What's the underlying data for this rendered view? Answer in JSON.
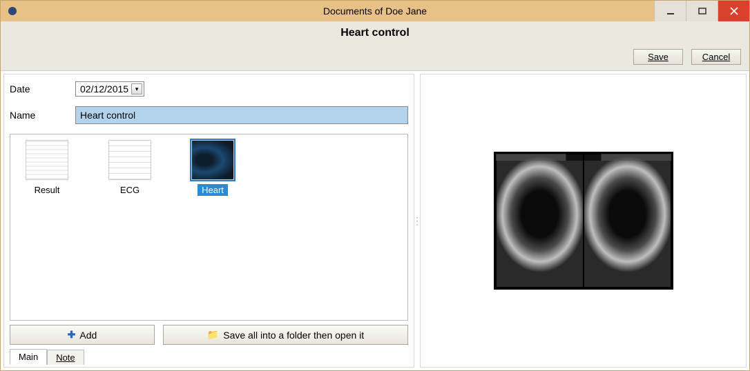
{
  "window": {
    "title": "Documents of Doe Jane"
  },
  "header": {
    "subtitle": "Heart control",
    "save_label": "Save",
    "cancel_label": "Cancel"
  },
  "form": {
    "date_label": "Date",
    "date_value": "02/12/2015",
    "name_label": "Name",
    "name_value": "Heart control"
  },
  "thumbnails": {
    "items": [
      {
        "label": "Result",
        "icon": "result-doc-icon",
        "selected": false
      },
      {
        "label": "ECG",
        "icon": "ecg-grid-icon",
        "selected": false
      },
      {
        "label": "Heart",
        "icon": "ultrasound-icon",
        "selected": true
      }
    ]
  },
  "actions": {
    "add_label": "Add",
    "saveall_label": "Save all into a folder then open it"
  },
  "tabs": {
    "items": [
      {
        "label": "Main",
        "active": true
      },
      {
        "label": "Note",
        "active": false
      }
    ]
  },
  "preview": {
    "kind": "ultrasound-image",
    "description": "Dual-view cardiac ultrasound preview"
  },
  "colors": {
    "titlebar_bg": "#e8c187",
    "close_bg": "#d9412c",
    "selection_bg": "#2a8ad4",
    "input_highlight": "#b3d3ed"
  }
}
